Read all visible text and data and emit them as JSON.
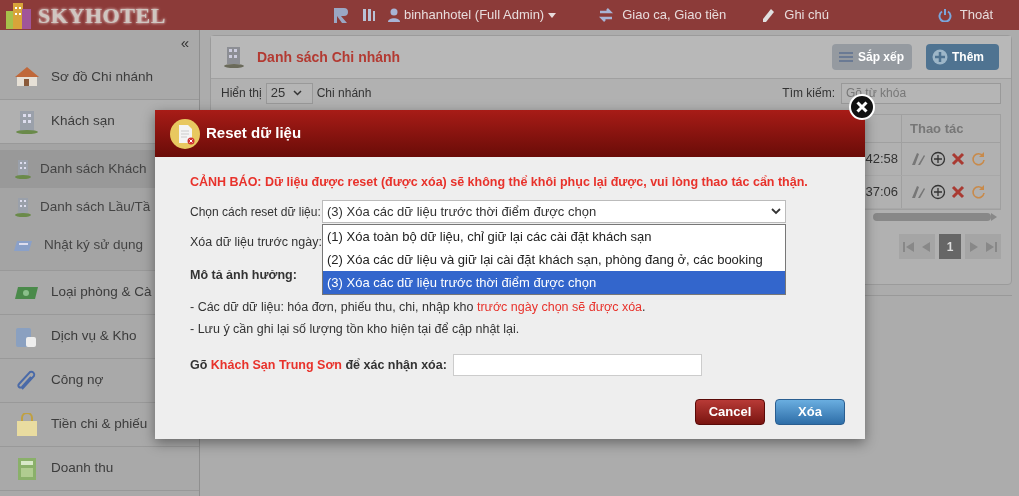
{
  "header": {
    "logo": "SKYHOTEL",
    "user": "binhanhotel (Full Admin)",
    "links": [
      {
        "label": "Giao ca, Giao tiền",
        "kind": "shift"
      },
      {
        "label": "Ghi chú",
        "kind": "note"
      }
    ],
    "logout": "Thoát"
  },
  "sidebar": {
    "collapse": "«",
    "items": [
      {
        "label": "Sơ đồ Chi nhánh",
        "kind": "house"
      },
      {
        "label": "Khách sạn",
        "kind": "building",
        "expanded": true,
        "children": [
          {
            "label": "Danh sách Khách",
            "selected": true
          },
          {
            "label": "Danh sách Lầu/Tầ",
            "selected": false
          },
          {
            "label": "Nhật ký sử dụng",
            "selected": false
          }
        ]
      },
      {
        "label": "Loại phòng & Cà",
        "kind": "money",
        "expanded": false
      },
      {
        "label": "Dịch vụ & Kho",
        "kind": "cup",
        "expanded": false
      },
      {
        "label": "Công nợ",
        "kind": "clip",
        "expanded": false
      },
      {
        "label": "Tiền chi & phiếu",
        "kind": "bag",
        "expanded": false
      },
      {
        "label": "Doanh thu",
        "kind": "calc",
        "expanded": false
      }
    ]
  },
  "panel": {
    "title": "Danh sách Chi nhánh",
    "buttons": [
      {
        "label": "Sắp xếp",
        "kind": "sort"
      },
      {
        "label": "Thêm",
        "kind": "add"
      }
    ],
    "show_label": "Hiển thị",
    "page_size": "25",
    "show_suffix": "Chi nhánh",
    "search_label": "Tìm kiếm:",
    "search_placeholder": "Gõ từ khóa",
    "table": {
      "columns": [
        "Thao tác"
      ],
      "rows": [
        {
          "column_1": "42:58"
        },
        {
          "column_1": "37:06"
        }
      ]
    },
    "pages": [
      {
        "label": "1",
        "selected": true
      }
    ]
  },
  "dialog": {
    "title": "Reset dữ liệu",
    "warning": "CẢNH BÁO: Dữ liệu được reset (được xóa) sẽ không thể khôi phục lại được, vui lòng thao tác cẩn thận.",
    "method_label": "Chọn cách reset dữ liệu:",
    "method_value": "(3) Xóa các dữ liệu trước thời điểm được chọn",
    "options": [
      {
        "label": "(1) Xóa toàn bộ dữ liệu, chỉ giữ lại các cài đặt khách sạn",
        "selected": false
      },
      {
        "label": "(2) Xóa các dữ liệu và giữ lại cài đặt khách sạn, phòng đang ở, các booking",
        "selected": false
      },
      {
        "label": "(3) Xóa các dữ liệu trước thời điểm được chọn",
        "selected": true
      }
    ],
    "date_label": "Xóa dữ liệu trước ngày:",
    "impact_title": "Mô tả ảnh hưởng:",
    "impact_lines": [
      [
        {
          "text": "- Các dữ dữ liệu: hóa đơn, phiếu thu, chi, nhập kho ",
          "highlight": false
        },
        {
          "text": "trước ngày chọn sẽ được xóa",
          "highlight": true
        },
        {
          "text": ".",
          "highlight": false
        }
      ],
      [
        {
          "text": "- Lưu ý cần ghi lại số lượng tồn kho hiện tại để cập nhật lại.",
          "highlight": false
        }
      ]
    ],
    "confirm": [
      {
        "text": "Gõ ",
        "highlight": false
      },
      {
        "text": "Khách Sạn Trung Sơn",
        "highlight": true
      },
      {
        "text": " để xác nhận xóa:",
        "highlight": false
      }
    ],
    "buttons": [
      {
        "label": "Cancel",
        "kind": "cancel"
      },
      {
        "label": "Xóa",
        "kind": "confirm"
      }
    ]
  }
}
